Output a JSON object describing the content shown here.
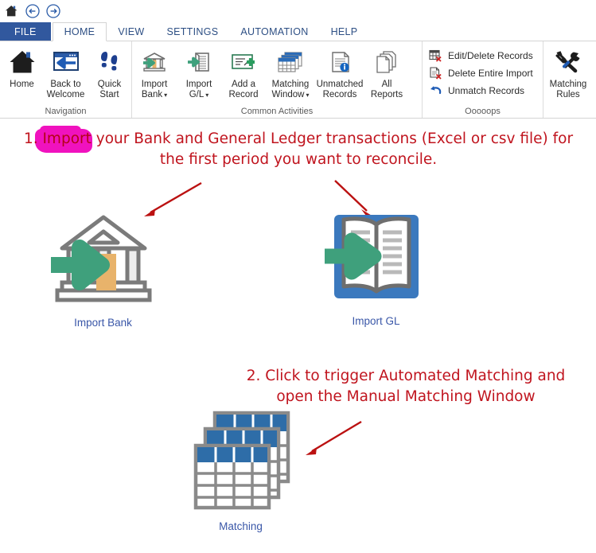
{
  "quick_access": {
    "items": [
      {
        "name": "home-icon",
        "title": "Home"
      },
      {
        "name": "back-icon",
        "title": "Back"
      },
      {
        "name": "forward-icon",
        "title": "Forward"
      }
    ]
  },
  "tabs": [
    {
      "id": "file",
      "label": "FILE",
      "active": false,
      "is_file": true
    },
    {
      "id": "home",
      "label": "HOME",
      "active": true,
      "is_file": false
    },
    {
      "id": "view",
      "label": "VIEW",
      "active": false,
      "is_file": false
    },
    {
      "id": "settings",
      "label": "SETTINGS",
      "active": false,
      "is_file": false
    },
    {
      "id": "automation",
      "label": "AUTOMATION",
      "active": false,
      "is_file": false
    },
    {
      "id": "help",
      "label": "HELP",
      "active": false,
      "is_file": false
    }
  ],
  "ribbon": {
    "groups": [
      {
        "id": "navigation",
        "title": "Navigation",
        "buttons": [
          {
            "id": "home",
            "label": "Home",
            "line2": "",
            "icon": "home-icon",
            "has_caret": false
          },
          {
            "id": "back-to-welcome",
            "label": "Back to",
            "line2": "Welcome",
            "icon": "back-to-welcome-icon",
            "has_caret": false
          },
          {
            "id": "quick-start",
            "label": "Quick",
            "line2": "Start",
            "icon": "footprints-icon",
            "has_caret": false
          }
        ]
      },
      {
        "id": "common-activities",
        "title": "Common Activities",
        "buttons": [
          {
            "id": "import-bank",
            "label": "Import",
            "line2": "Bank",
            "icon": "bank-import-icon",
            "has_caret": true
          },
          {
            "id": "import-gl",
            "label": "Import",
            "line2": "G/L",
            "icon": "ledger-import-icon",
            "has_caret": true
          },
          {
            "id": "add-a-record",
            "label": "Add a",
            "line2": "Record",
            "icon": "add-record-icon",
            "has_caret": false
          },
          {
            "id": "matching-window",
            "label": "Matching",
            "line2": "Window",
            "icon": "matching-window-icon",
            "has_caret": true
          },
          {
            "id": "unmatched-records",
            "label": "Unmatched",
            "line2": "Records",
            "icon": "unmatched-records-icon",
            "has_caret": false
          },
          {
            "id": "all-reports",
            "label": "All",
            "line2": "Reports",
            "icon": "all-reports-icon",
            "has_caret": false
          }
        ]
      },
      {
        "id": "ooooops",
        "title": "Ooooops",
        "small_buttons": [
          {
            "id": "edit-delete-records",
            "label": "Edit/Delete Records",
            "icon": "edit-delete-records-icon"
          },
          {
            "id": "delete-entire-import",
            "label": "Delete Entire Import",
            "icon": "delete-entire-import-icon"
          },
          {
            "id": "unmatch-records",
            "label": "Unmatch Records",
            "icon": "undo-icon"
          }
        ]
      },
      {
        "id": "matching-rules-group",
        "title": "",
        "buttons": [
          {
            "id": "matching-rules",
            "label": "Matching",
            "line2": "Rules",
            "icon": "tools-icon",
            "has_caret": false
          }
        ]
      }
    ]
  },
  "canvas": {
    "step1_text": "1. Import your Bank and General Ledger transactions (Excel or csv file) for the first period you want to reconcile.",
    "step2_text": "2. Click to trigger Automated Matching and open the Manual Matching Window",
    "tiles": [
      {
        "id": "import-bank-tile",
        "label": "Import Bank",
        "icon": "bank-building-icon"
      },
      {
        "id": "import-gl-tile",
        "label": "Import GL",
        "icon": "open-book-icon"
      },
      {
        "id": "matching-tile",
        "label": "Matching",
        "icon": "stacked-tables-icon"
      }
    ],
    "annotation_arrows": [
      {
        "id": "arrow-to-bank",
        "from": "upper-right",
        "to": "lower-left"
      },
      {
        "id": "arrow-to-gl",
        "from": "upper-left",
        "to": "lower-right"
      },
      {
        "id": "arrow-to-matching",
        "from": "upper-right",
        "to": "lower-left"
      }
    ],
    "highlight": {
      "id": "magenta-highlight",
      "covers": "1. Import"
    }
  },
  "colors": {
    "file_tab_blue": "#31589E",
    "tab_text_blue": "#2d4f84",
    "annotation_red": "#c0141e",
    "highlight_magenta": "#f012be",
    "tile_label_blue": "#3a57a8",
    "icon_green": "#3FA07C",
    "icon_blue": "#3B79BE",
    "icon_gray": "#7a7a7a",
    "icon_orange": "#E8B36B"
  }
}
